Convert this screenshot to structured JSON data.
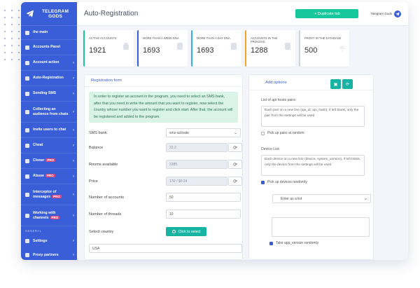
{
  "brand": {
    "name_line1": "TELEGRAM",
    "name_line2": "GODS"
  },
  "sidebar": {
    "items": [
      {
        "label": "the main",
        "chevron": ""
      },
      {
        "label": "Accounts Panel",
        "chevron": ""
      },
      {
        "label": "Account action",
        "chevron": "›"
      },
      {
        "label": "Auto-Registration",
        "chevron": "›"
      },
      {
        "label": "Sending SMS",
        "chevron": "›"
      },
      {
        "label": "Collecting an audience from chats",
        "chevron": "›"
      },
      {
        "label": "Invite users to chat",
        "chevron": "›"
      },
      {
        "label": "Cheat",
        "chevron": "›"
      },
      {
        "label": "Cloner",
        "pro": "PRO",
        "chevron": "›"
      },
      {
        "label": "Abuse",
        "pro": "PRO",
        "chevron": "›"
      },
      {
        "label": "Interceptor of messages",
        "pro": "PRO",
        "chevron": "›"
      },
      {
        "label": "Working with channels",
        "pro": "PRO",
        "chevron": "›"
      }
    ],
    "section": "GENERAL",
    "bottom": [
      {
        "label": "Settings",
        "chevron": "›"
      },
      {
        "label": "Proxy partners",
        "chevron": "›"
      }
    ]
  },
  "header": {
    "title": "Auto-Registration",
    "duplicate_label": "+ Duplicate tab",
    "user_name": "Telegram Gods"
  },
  "stats": [
    {
      "label": "ACTIVE ACCOUNTS",
      "value": "1921"
    },
    {
      "label": "MORE THAN A WEEK ENA",
      "value": "1693"
    },
    {
      "label": "MORE THAN A DAY ENA",
      "value": "1693"
    },
    {
      "label": "ACCOUNTS IN THE PROCESS",
      "value": "1288"
    },
    {
      "label": "PROXY IN THE DATABASE",
      "value": "500"
    }
  ],
  "registration": {
    "title": "Registration form",
    "notice": "In order to register an account in the program, you need to select an SMS bank, after that you need to write the amount that you want to register, now select the country whose number you want to register and click start. After that, the account will be registered and added to the program.",
    "sms_bank_label": "SMS bank",
    "sms_bank_value": "sms-activate",
    "balance_label": "Balance",
    "balance_value": "22.2",
    "rooms_label": "Rooms available",
    "rooms_value": "2285",
    "price_label": "Price",
    "price_value": "17₽ / $0.24",
    "accounts_label": "Number of accounts",
    "accounts_value": "50",
    "threads_label": "Number of threads",
    "threads_value": "10",
    "country_label": "Select country",
    "country_button": "Click to select",
    "country_value": "USA"
  },
  "options": {
    "title": "Add options",
    "api_caption": "List of api hosts pairs:",
    "api_placeholder": "Each pair on a new line (api_id, api_hash), if left blank, only the pair from the settings will be used",
    "api_random_label": "Pick up pairs at random",
    "device_caption": "Device List:",
    "device_placeholder": "Each device on a new line (device, system_version), if left blank, only the device from the settings will be used",
    "device_random_label": "Pick up devices randomly",
    "mode_value": "Enter as a list",
    "app_version_label": "Take app_version randomly"
  },
  "colors": {
    "sidebar": "#3a5ed8",
    "accent_green": "#16c89b",
    "teal": "#17b3a3",
    "pro_badge": "#e0457b"
  }
}
